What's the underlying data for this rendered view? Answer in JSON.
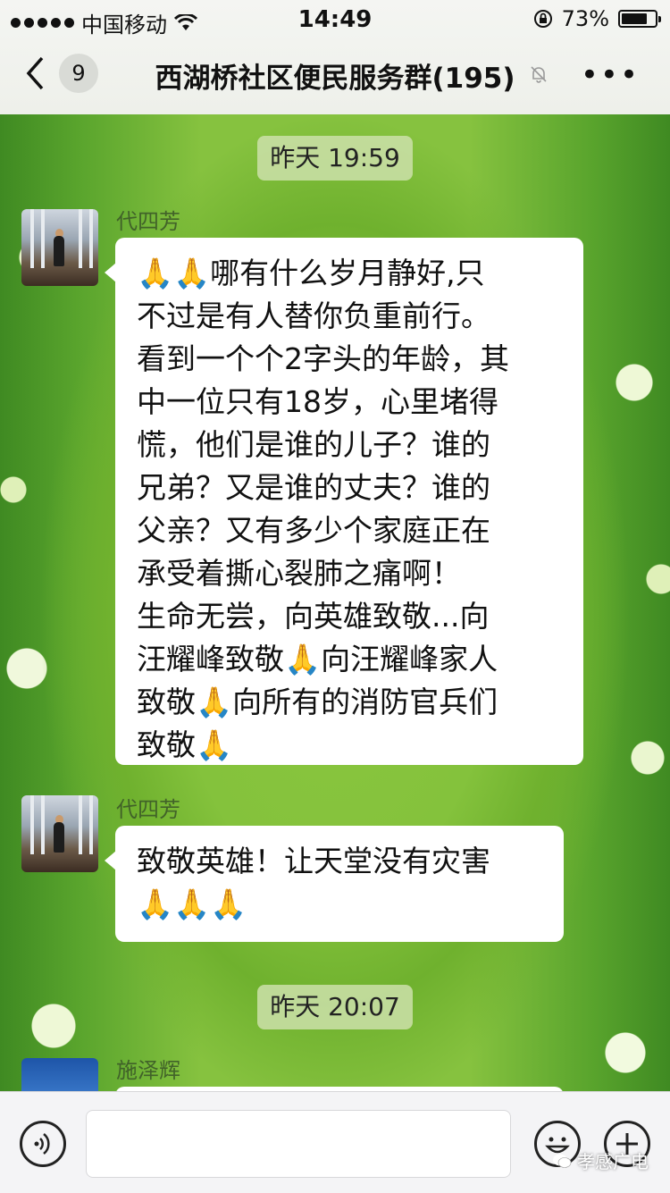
{
  "status_bar": {
    "carrier": "中国移动",
    "time": "14:49",
    "battery": "73%",
    "icons": [
      "signal-dots-icon",
      "wifi-icon",
      "rotation-lock-icon",
      "battery-icon"
    ]
  },
  "nav": {
    "unread_count": "9",
    "title": "西湖桥社区便民服务群(195)",
    "icons": [
      "back-chevron-icon",
      "mute-bell-icon",
      "more-dots-icon"
    ],
    "more_label": "•••"
  },
  "messages": [
    {
      "type": "timestamp",
      "text": "昨天 19:59"
    },
    {
      "type": "message",
      "sender": "代四芳",
      "lines": [
        "🙏🙏哪有什么岁月静好,只",
        "不过是有人替你负重前行。",
        "看到一个个2字头的年龄，其",
        "中一位只有18岁，心里堵得",
        "慌，他们是谁的儿子？谁的",
        "兄弟？又是谁的丈夫？谁的",
        "父亲？又有多少个家庭正在",
        "承受着撕心裂肺之痛啊！",
        "生命无尝，向英雄致敬...向",
        "汪耀峰致敬🙏向汪耀峰家人",
        "致敬🙏向所有的消防官兵们",
        "致敬🙏"
      ]
    },
    {
      "type": "message",
      "sender": "代四芳",
      "lines": [
        "致敬英雄！让天堂没有灾害",
        "🙏🙏🙏"
      ]
    },
    {
      "type": "timestamp",
      "text": "昨天 20:07"
    },
    {
      "type": "message",
      "sender": "施泽辉",
      "lines": []
    }
  ],
  "input_bar": {
    "icons": [
      "voice-icon",
      "emoji-icon",
      "plus-icon"
    ],
    "watermark": "孝感广电"
  }
}
